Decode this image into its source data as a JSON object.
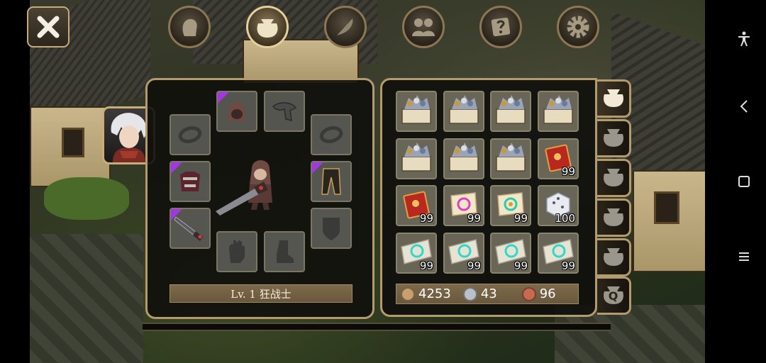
{
  "top_tabs": [
    {
      "icon": "character-head-icon",
      "active": false
    },
    {
      "icon": "bag-icon",
      "active": true
    },
    {
      "icon": "skill-feather-icon",
      "active": false
    },
    {
      "icon": "party-icon",
      "active": false
    },
    {
      "icon": "quest-scroll-icon",
      "active": false
    },
    {
      "icon": "settings-gear-icon",
      "active": false
    }
  ],
  "character": {
    "level_text": "Lv. 1 狂战士"
  },
  "equipment_slots": [
    {
      "slot": "helmet",
      "icon": "hood-icon",
      "rarity": "purple"
    },
    {
      "slot": "cape",
      "icon": "scarf-icon",
      "rarity": "none"
    },
    {
      "slot": "ring-left",
      "icon": "ring-icon",
      "rarity": "none"
    },
    {
      "slot": "ring-right",
      "icon": "ring-icon",
      "rarity": "none"
    },
    {
      "slot": "armor",
      "icon": "armor-icon",
      "rarity": "purple"
    },
    {
      "slot": "pants",
      "icon": "pants-icon",
      "rarity": "purple"
    },
    {
      "slot": "weapon",
      "icon": "sword-icon",
      "rarity": "purple"
    },
    {
      "slot": "shield",
      "icon": "shield-icon",
      "rarity": "none"
    },
    {
      "slot": "gloves",
      "icon": "glove-icon",
      "rarity": "none"
    },
    {
      "slot": "boots",
      "icon": "boot-icon",
      "rarity": "none"
    }
  ],
  "inventory": [
    {
      "icon": "treasure-box-icon",
      "qty": ""
    },
    {
      "icon": "treasure-box-icon",
      "qty": ""
    },
    {
      "icon": "treasure-box-icon",
      "qty": ""
    },
    {
      "icon": "treasure-box-icon",
      "qty": ""
    },
    {
      "icon": "treasure-box-icon",
      "qty": ""
    },
    {
      "icon": "treasure-box-icon",
      "qty": ""
    },
    {
      "icon": "treasure-box-icon",
      "qty": ""
    },
    {
      "icon": "red-book-icon",
      "qty": "99"
    },
    {
      "icon": "red-book-icon",
      "qty": "99"
    },
    {
      "icon": "pink-scroll-icon",
      "qty": "99"
    },
    {
      "icon": "gold-scroll-icon",
      "qty": "99"
    },
    {
      "icon": "dice-icon",
      "qty": "100"
    },
    {
      "icon": "teal-scroll-icon",
      "qty": "99"
    },
    {
      "icon": "teal-scroll-icon",
      "qty": "99"
    },
    {
      "icon": "teal-scroll-icon",
      "qty": "99"
    },
    {
      "icon": "teal-scroll-icon",
      "qty": "99"
    }
  ],
  "currency": {
    "gold": "4253",
    "silver": "43",
    "copper": "96",
    "gold_color": "#c8a070",
    "silver_color": "#b8c0c8",
    "copper_color": "#c76a50"
  },
  "bag_tabs": [
    {
      "icon": "bag-icon",
      "active": true,
      "label": ""
    },
    {
      "icon": "bag-icon",
      "active": false,
      "label": ""
    },
    {
      "icon": "bag-icon",
      "active": false,
      "label": ""
    },
    {
      "icon": "bag-icon",
      "active": false,
      "label": ""
    },
    {
      "icon": "bag-icon",
      "active": false,
      "label": ""
    },
    {
      "icon": "quest-bag-icon",
      "active": false,
      "label": "Q"
    }
  ],
  "system_nav": [
    {
      "icon": "accessibility-icon"
    },
    {
      "icon": "back-icon"
    },
    {
      "icon": "home-icon"
    },
    {
      "icon": "recents-icon"
    }
  ]
}
